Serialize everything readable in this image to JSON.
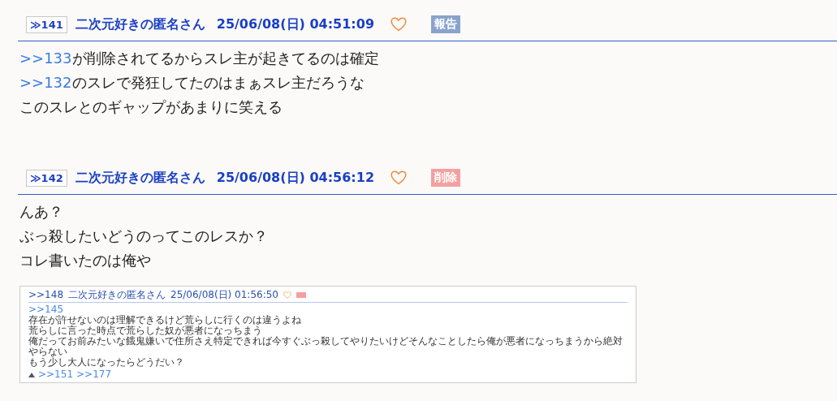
{
  "posts": [
    {
      "number": "≫141",
      "name": "二次元好きの匿名さん",
      "date": "25/06/08(日) 04:51:09",
      "action": {
        "kind": "report",
        "label": "報告"
      },
      "lines": [
        [
          {
            "kind": "link",
            "text": ">>133"
          },
          {
            "kind": "text",
            "text": "が削除されてるからスレ主が起きてるのは確定"
          }
        ],
        [
          {
            "kind": "link",
            "text": ">>132"
          },
          {
            "kind": "text",
            "text": "のスレで発狂してたのはまぁスレ主だろうな"
          }
        ],
        [
          {
            "kind": "text",
            "text": "このスレとのギャップがあまりに笑える"
          }
        ]
      ]
    },
    {
      "number": "≫142",
      "name": "二次元好きの匿名さん",
      "date": "25/06/08(日) 04:56:12",
      "action": {
        "kind": "delete",
        "label": "削除"
      },
      "lines": [
        [
          {
            "kind": "text",
            "text": "んあ？"
          }
        ],
        [
          {
            "kind": "text",
            "text": "ぶっ殺したいどうのってこのレスか？"
          }
        ],
        [
          {
            "kind": "text",
            "text": "コレ書いたのは俺や"
          }
        ]
      ],
      "attachment": {
        "kind": "screenshot",
        "number": ">>148",
        "name": "二次元好きの匿名さん",
        "date": "25/06/08(日) 01:56:50",
        "link": ">>145",
        "lines": [
          "存在が許せないのは理解できるけど荒らしに行くのは違うよね",
          "荒らしに言った時点で荒らした奴が悪者になっちまう",
          "俺だってお前みたいな餓鬼嫌いで住所さえ特定できれば今すぐぶっ殺してやりたいけどそんなことしたら俺が悪者になっちまうから絶対やらない",
          "もう少し大人になったらどうだい？"
        ],
        "replies": [
          ">>151",
          ">>177"
        ]
      }
    }
  ]
}
